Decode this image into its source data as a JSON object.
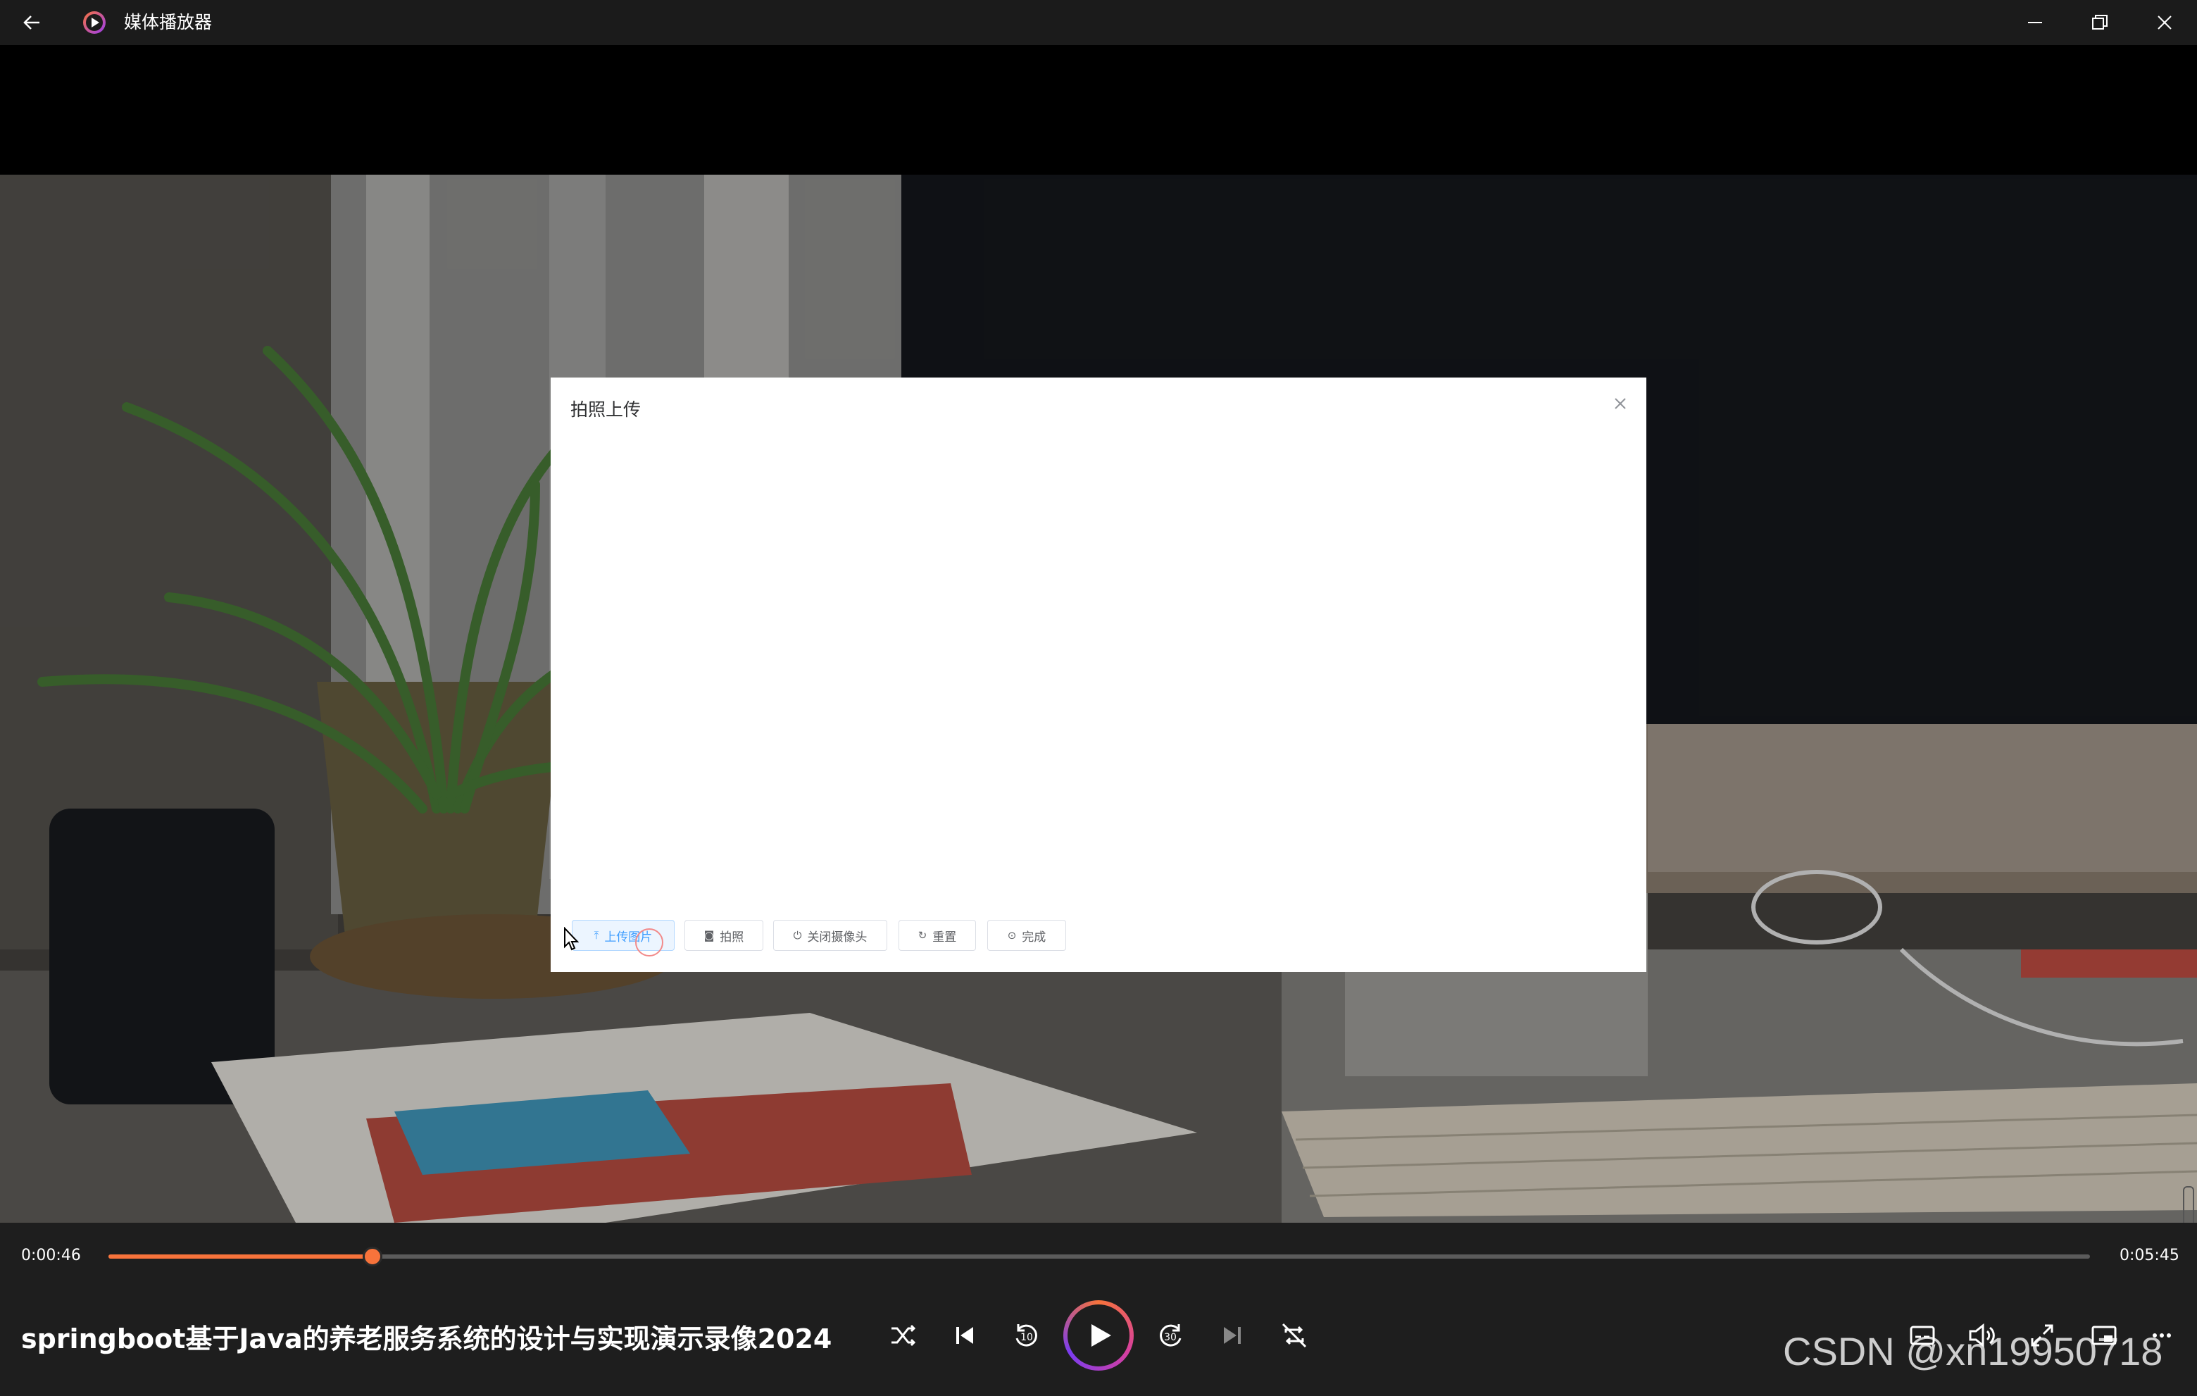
{
  "app": {
    "title": "媒体播放器"
  },
  "modal": {
    "title": "拍照上传",
    "buttons": [
      {
        "label": "上传图片",
        "icon": "upload-icon"
      },
      {
        "label": "拍照",
        "icon": "camera-icon"
      },
      {
        "label": "关闭摄像头",
        "icon": "power-icon"
      },
      {
        "label": "重置",
        "icon": "refresh-icon"
      },
      {
        "label": "完成",
        "icon": "check-circle-icon"
      }
    ]
  },
  "player": {
    "current_time": "0:00:46",
    "total_time": "0:05:45",
    "progress": 0.1333,
    "media_title": "springboot基于Java的养老服务系统的设计与实现演示录像2024"
  },
  "watermark": "CSDN @xn19950718",
  "colors": {
    "accent": "#f7733b",
    "primary_button": "#409eff"
  }
}
